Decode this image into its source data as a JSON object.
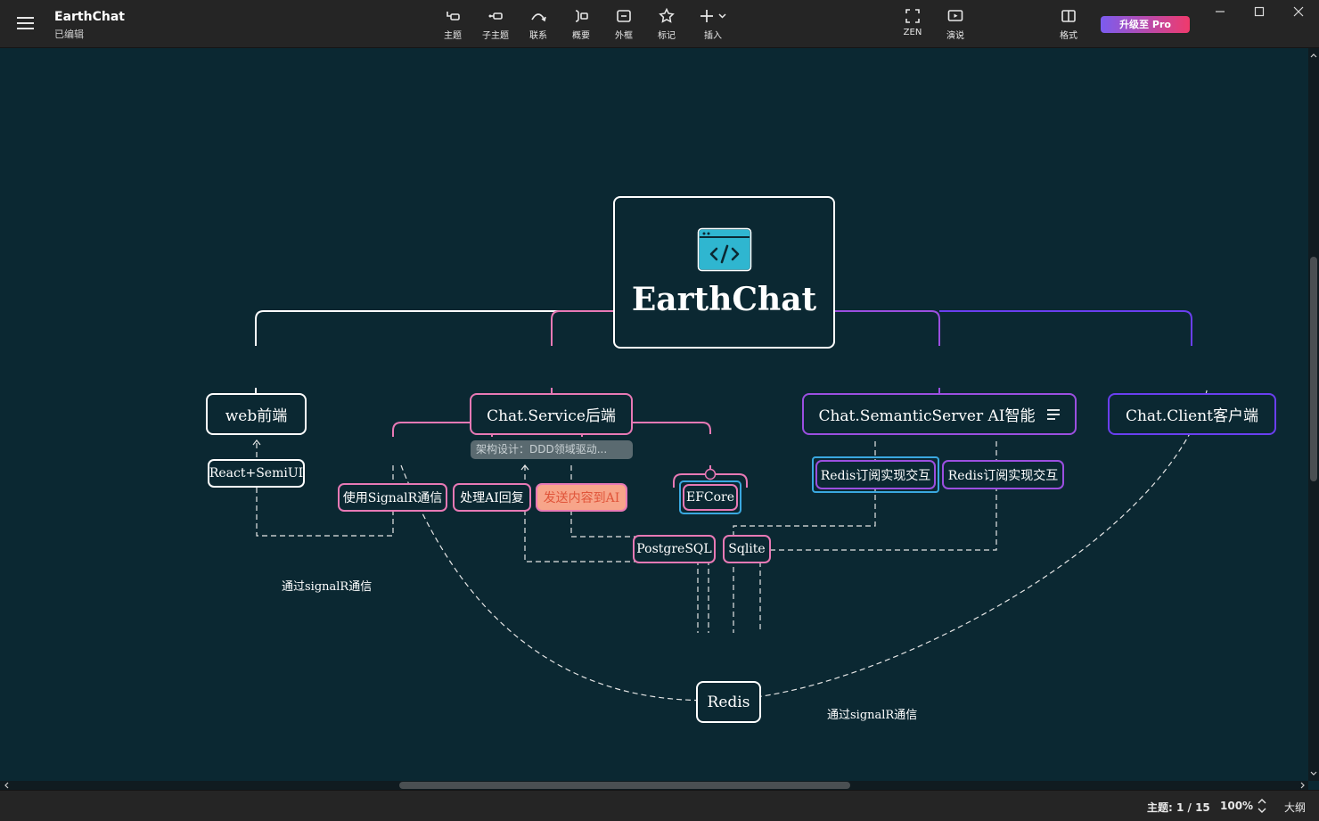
{
  "app": {
    "title": "EarthChat",
    "status": "已编辑"
  },
  "toolbar": {
    "topic": "主题",
    "subtopic": "子主题",
    "relation": "联系",
    "summary": "概要",
    "boundary": "外框",
    "marker": "标记",
    "insert": "插入",
    "zen": "ZEN",
    "present": "演说",
    "format": "格式",
    "upgrade": "升级至 Pro"
  },
  "colors": {
    "background": "#0b2832",
    "branch_white": "#ffffff",
    "branch_pink": "#e879b5",
    "branch_purple": "#9b4fe0",
    "branch_indigo": "#6a3ff0",
    "highlight_orange": "#f7a58a",
    "ef_blue": "#3aa8e0"
  },
  "mindmap": {
    "root": {
      "label": "EarthChat",
      "icon": "code-window-icon"
    },
    "web": {
      "label": "web前端",
      "child": "React+SemiUI"
    },
    "service": {
      "label": "Chat.Service后端",
      "summary": "架构设计：DDD领域驱动...",
      "children": [
        "使用SignalR通信",
        "处理AI回复",
        "发送内容到AI",
        "EFCore"
      ],
      "efcore_children": [
        "PostgreSQL",
        "Sqlite"
      ]
    },
    "semantic": {
      "label": "Chat.SemanticServer AI智能",
      "children": [
        "Redis订阅实现交互",
        "Redis订阅实现交互"
      ]
    },
    "client": {
      "label": "Chat.Client客户端"
    },
    "redis": {
      "label": "Redis"
    },
    "relations": [
      "通过signalR通信",
      "通过signalR通信"
    ]
  },
  "status": {
    "topic_count": "主题: 1 / 15",
    "zoom": "100%",
    "outline": "大纲"
  }
}
